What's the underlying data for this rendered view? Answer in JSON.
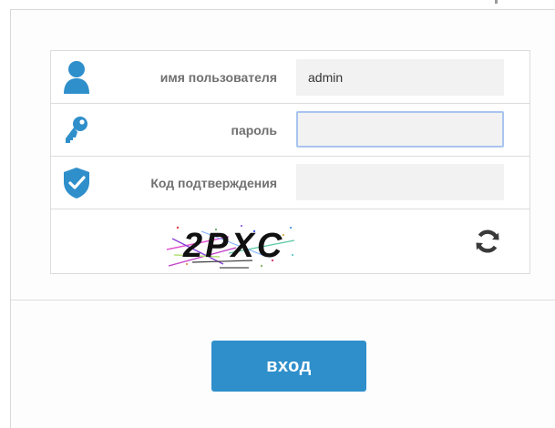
{
  "login_form": {
    "username": {
      "label": "имя пользователя",
      "value": "admin",
      "icon": "user-icon"
    },
    "password": {
      "label": "пароль",
      "value": "",
      "icon": "key-icon"
    },
    "captcha_code": {
      "label": "Код подтверждения",
      "value": "",
      "icon": "shield-check-icon"
    },
    "captcha": {
      "text": "2PXC",
      "refresh_icon": "refresh-icon"
    },
    "submit_label": "вход"
  },
  "colors": {
    "icon_blue": "#2f8fcb",
    "button_blue": "#2f8fcb",
    "label_gray": "#707070",
    "field_bg": "#f2f2f2",
    "focus_border": "#a8c4ef",
    "refresh_gray": "#3a3a3a"
  }
}
